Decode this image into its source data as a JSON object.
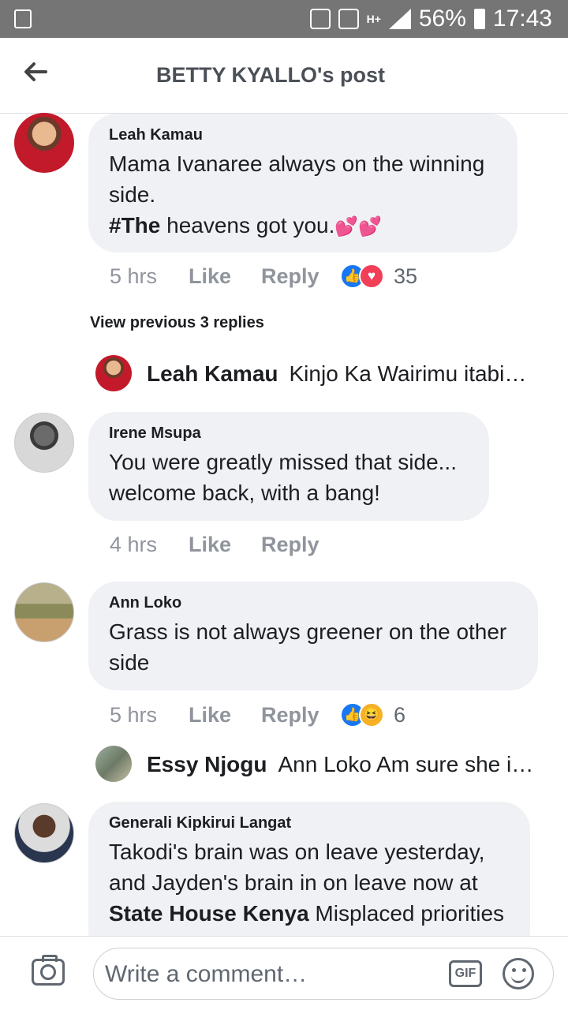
{
  "status_bar": {
    "battery": "56%",
    "time": "17:43",
    "network": "H+"
  },
  "header": {
    "title": "BETTY KYALLO's post"
  },
  "comments": [
    {
      "author": "Leah Kamau",
      "text_line1": "Mama Ivanaree always on the winning side.",
      "text_bold": "#The",
      "text_line2": " heavens got you.",
      "emoji": "💕💕",
      "time": "5 hrs",
      "like": "Like",
      "reply": "Reply",
      "reaction_count": "35"
    },
    {
      "author": "Irene Msupa",
      "text": "You were greatly missed that side... welcome back, with a bang!",
      "time": "4 hrs",
      "like": "Like",
      "reply": "Reply"
    },
    {
      "author": "Ann Loko",
      "text": "Grass is not always greener on the other side",
      "time": "5 hrs",
      "like": "Like",
      "reply": "Reply",
      "reaction_count": "6"
    },
    {
      "author": "Generali Kipkirui Langat",
      "text_part1": "Takodi's brain was on leave yesterday, and Jayden's brain in on leave now at ",
      "text_bold": "State House Kenya",
      "text_part2": " Misplaced priorities"
    }
  ],
  "view_previous": "View previous 3 replies",
  "replies": [
    {
      "author": "Leah Kamau",
      "text": "Kinjo Ka Wairimu itabi…"
    },
    {
      "author": "Essy Njogu",
      "text": "Ann Loko Am sure she i…"
    }
  ],
  "composer": {
    "placeholder": "Write a comment…",
    "gif_label": "GIF"
  },
  "colors": {
    "like_blue": "#1877f2",
    "love_red": "#f33e58",
    "haha_yellow": "#f7b125"
  }
}
